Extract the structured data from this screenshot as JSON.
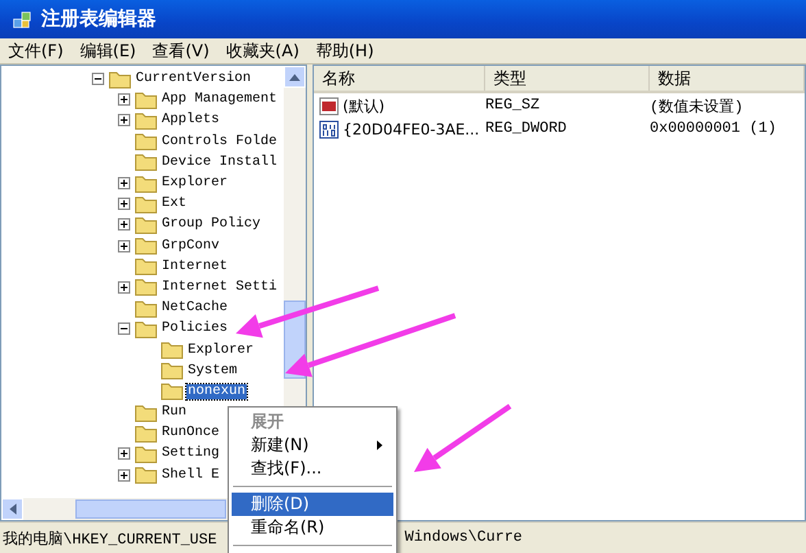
{
  "window": {
    "title": "注册表编辑器"
  },
  "menu_bar": [
    "文件(F)",
    "编辑(E)",
    "查看(V)",
    "收藏夹(A)",
    "帮助(H)"
  ],
  "tree": [
    {
      "label": "CurrentVersion",
      "kind": "expanded",
      "selected": false,
      "children": [
        {
          "label": "App Management",
          "kind": "collapsed",
          "selected": false
        },
        {
          "label": "Applets",
          "kind": "collapsed",
          "selected": false
        },
        {
          "label": "Controls Folde",
          "kind": "leaf",
          "selected": false
        },
        {
          "label": "Device Install",
          "kind": "leaf",
          "selected": false
        },
        {
          "label": "Explorer",
          "kind": "collapsed",
          "selected": false
        },
        {
          "label": "Ext",
          "kind": "collapsed",
          "selected": false
        },
        {
          "label": "Group Policy",
          "kind": "collapsed",
          "selected": false
        },
        {
          "label": "GrpConv",
          "kind": "collapsed",
          "selected": false
        },
        {
          "label": "Internet",
          "kind": "leaf",
          "selected": false
        },
        {
          "label": "Internet Setti",
          "kind": "collapsed",
          "selected": false
        },
        {
          "label": "NetCache",
          "kind": "leaf",
          "selected": false
        },
        {
          "label": "Policies",
          "kind": "expanded",
          "selected": false,
          "children": [
            {
              "label": "Explorer",
              "kind": "leaf",
              "selected": false
            },
            {
              "label": "System",
              "kind": "leaf",
              "selected": false
            },
            {
              "label": "nonexun",
              "kind": "leaf",
              "selected": true
            }
          ]
        },
        {
          "label": "Run",
          "kind": "leaf",
          "selected": false
        },
        {
          "label": "RunOnce",
          "kind": "leaf",
          "selected": false
        },
        {
          "label": "Setting",
          "kind": "collapsed",
          "selected": false
        },
        {
          "label": "Shell E",
          "kind": "collapsed",
          "selected": false
        }
      ]
    }
  ],
  "values": {
    "columns": [
      "名称",
      "类型",
      "数据"
    ],
    "rows": [
      {
        "kind": "string",
        "name": "(默认)",
        "type": "REG_SZ",
        "data": "(数值未设置)"
      },
      {
        "kind": "binary",
        "name": "{20D04FE0-3AE...",
        "type": "REG_DWORD",
        "data": "0x00000001 (1)"
      }
    ]
  },
  "context_menu": [
    {
      "kind": "item",
      "label": "展开",
      "disabled": true,
      "bold": true,
      "submenu": false,
      "selected": false
    },
    {
      "kind": "item",
      "label": "新建(N)",
      "disabled": false,
      "bold": false,
      "submenu": true,
      "selected": false
    },
    {
      "kind": "item",
      "label": "查找(F)...",
      "disabled": false,
      "bold": false,
      "submenu": false,
      "selected": false
    },
    {
      "kind": "separator"
    },
    {
      "kind": "item",
      "label": "删除(D)",
      "disabled": false,
      "bold": false,
      "submenu": false,
      "selected": true
    },
    {
      "kind": "item",
      "label": "重命名(R)",
      "disabled": false,
      "bold": false,
      "submenu": false,
      "selected": false
    },
    {
      "kind": "separator"
    }
  ],
  "status_bar": [
    "我的电脑\\HKEY_CURRENT_USE",
    "Windows\\Curre"
  ]
}
